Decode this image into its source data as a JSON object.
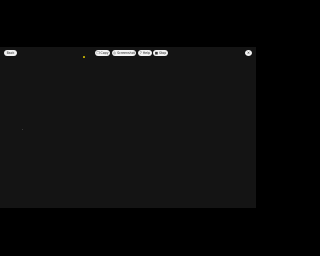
{
  "toolbar": {
    "back_label": "Back",
    "buttons": [
      {
        "icon": "copy-icon",
        "glyph": "❐",
        "label": "Copy"
      },
      {
        "icon": "screenshot-icon",
        "glyph": "◎",
        "label": "Screenshot"
      },
      {
        "icon": "help-icon",
        "glyph": "?",
        "label": "Help"
      },
      {
        "icon": "stop-icon",
        "glyph": "■",
        "label": "Stop"
      }
    ],
    "close_glyph": "✕"
  },
  "colors": {
    "letterbox": "#000000",
    "viewport": "#141414",
    "pill": "#f2f2f2",
    "cursor": "#c8b400"
  }
}
